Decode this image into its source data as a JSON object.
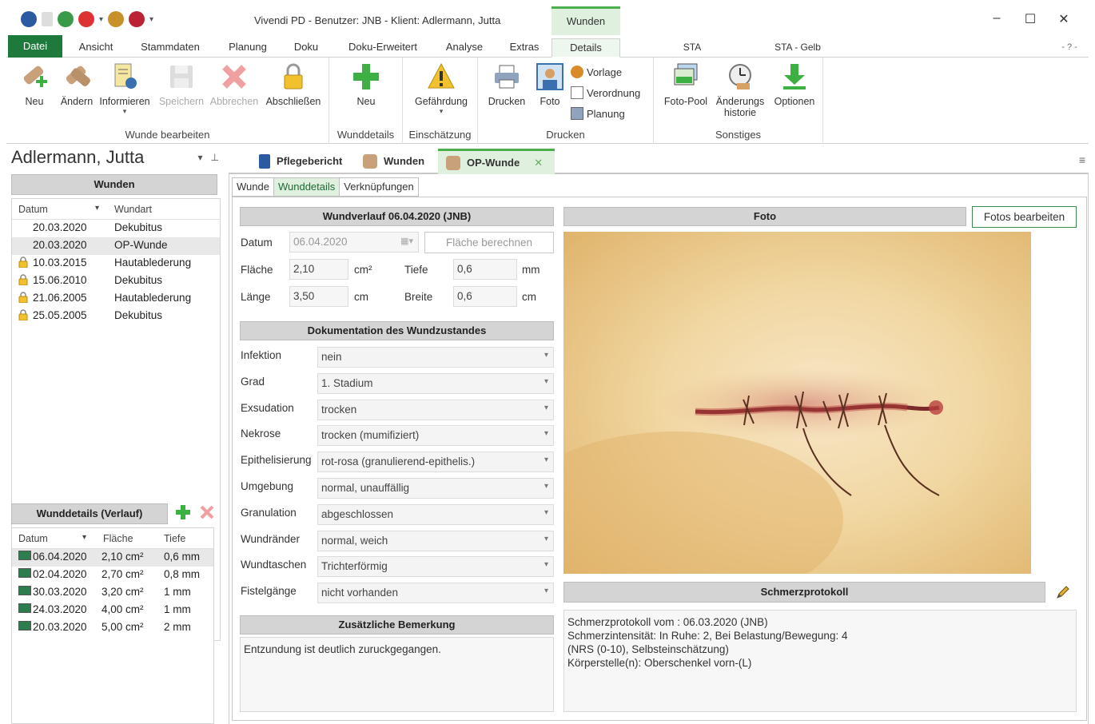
{
  "window": {
    "title": "Vivendi PD - Benutzer: JNB - Klient: Adlermann, Jutta",
    "context_tab": "Wunden",
    "controls": [
      "–",
      "☐",
      "✕"
    ]
  },
  "ribbon_tabs": [
    "Datei",
    "Ansicht",
    "Stammdaten",
    "Planung",
    "Doku",
    "Doku-Erweitert",
    "Analyse",
    "Extras",
    "Details"
  ],
  "ribbon_right": {
    "sta": "STA",
    "sta_gelb": "STA - Gelb",
    "help": "- ? -"
  },
  "ribbon": {
    "groups": {
      "wunde_bearbeiten": "Wunde bearbeiten",
      "wunddetails": "Wunddetails",
      "einschaetzung": "Einschätzung",
      "drucken": "Drucken",
      "sonstiges": "Sonstiges"
    },
    "buttons": {
      "neu": "Neu",
      "aendern": "Ändern",
      "informieren": "Informieren",
      "speichern": "Speichern",
      "abbrechen": "Abbrechen",
      "abschliessen": "Abschließen",
      "neu_details": "Neu",
      "gefaehrdung": "Gefährdung",
      "drucken": "Drucken",
      "foto": "Foto",
      "vorlage": "Vorlage",
      "verordnung": "Verordnung",
      "planung": "Planung",
      "foto_pool": "Foto-Pool",
      "aenderungs_l1": "Änderungs",
      "aenderungs_l2": "historie",
      "optionen": "Optionen"
    },
    "icon_colors": {
      "green": "#3cb043",
      "bandage": "#c8a079",
      "red": "#e06060",
      "yellow": "#f2c12e",
      "blue": "#3a6fb0"
    }
  },
  "left": {
    "patient": "Adlermann, Jutta",
    "wunden_header": "Wunden",
    "wunden_cols": [
      "Datum",
      "Wundart"
    ],
    "wunden": [
      {
        "datum": "20.03.2020",
        "art": "Dekubitus",
        "locked": false,
        "selected": false
      },
      {
        "datum": "20.03.2020",
        "art": "OP-Wunde",
        "locked": false,
        "selected": true
      },
      {
        "datum": "10.03.2015",
        "art": "Hautablederung",
        "locked": true,
        "selected": false
      },
      {
        "datum": "15.06.2010",
        "art": "Dekubitus",
        "locked": true,
        "selected": false
      },
      {
        "datum": "21.06.2005",
        "art": "Hautablederung",
        "locked": true,
        "selected": false
      },
      {
        "datum": "25.05.2005",
        "art": "Dekubitus",
        "locked": true,
        "selected": false
      }
    ],
    "verlauf_header": "Wunddetails (Verlauf)",
    "verlauf_cols": [
      "Datum",
      "Fläche",
      "Tiefe"
    ],
    "verlauf": [
      {
        "datum": "06.04.2020",
        "flaeche": "2,10 cm²",
        "tiefe": "0,6 mm"
      },
      {
        "datum": "02.04.2020",
        "flaeche": "2,70 cm²",
        "tiefe": "0,8 mm"
      },
      {
        "datum": "30.03.2020",
        "flaeche": "3,20 cm²",
        "tiefe": "1 mm"
      },
      {
        "datum": "24.03.2020",
        "flaeche": "4,00 cm²",
        "tiefe": "1 mm"
      },
      {
        "datum": "20.03.2020",
        "flaeche": "5,00 cm²",
        "tiefe": "2 mm"
      }
    ]
  },
  "doc_tabs": [
    "Pflegebericht",
    "Wunden",
    "OP-Wunde"
  ],
  "sub_tabs": [
    "Wunde",
    "Wunddetails",
    "Verknüpfungen"
  ],
  "verlauf_section": {
    "header": "Wundverlauf 06.04.2020 (JNB)",
    "datum_label": "Datum",
    "datum_value": "06.04.2020",
    "flaeche_btn": "Fläche berechnen",
    "flaeche_label": "Fläche",
    "flaeche_value": "2,10",
    "flaeche_unit": "cm²",
    "tiefe_label": "Tiefe",
    "tiefe_value": "0,6",
    "tiefe_unit": "mm",
    "laenge_label": "Länge",
    "laenge_value": "3,50",
    "laenge_unit": "cm",
    "breite_label": "Breite",
    "breite_value": "0,6",
    "breite_unit": "cm"
  },
  "doku_section": {
    "header": "Dokumentation des Wundzustandes",
    "rows": [
      {
        "label": "Infektion",
        "value": "nein"
      },
      {
        "label": "Grad",
        "value": "1. Stadium"
      },
      {
        "label": "Exsudation",
        "value": "trocken"
      },
      {
        "label": "Nekrose",
        "value": "trocken (mumifiziert)"
      },
      {
        "label": "Epithelisierung",
        "value": "rot-rosa (granulierend-epithelis.)"
      },
      {
        "label": "Umgebung",
        "value": "normal, unauffällig"
      },
      {
        "label": "Granulation",
        "value": "abgeschlossen"
      },
      {
        "label": "Wundränder",
        "value": "normal, weich"
      },
      {
        "label": "Wundtaschen",
        "value": "Trichterförmig"
      },
      {
        "label": "Fistelgänge",
        "value": "nicht vorhanden"
      }
    ]
  },
  "bemerkung": {
    "header": "Zusätzliche Bemerkung",
    "text": "Entzundung ist deutlich zuruckgegangen."
  },
  "foto": {
    "header": "Foto",
    "button": "Fotos bearbeiten"
  },
  "schmerz": {
    "header": "Schmerzprotokoll",
    "lines": [
      "Schmerzprotokoll vom : 06.03.2020 (JNB)",
      "Schmerzintensität: In Ruhe: 2, Bei Belastung/Bewegung: 4",
      "(NRS (0-10), Selbsteinschätzung)",
      "Körperstelle(n): Oberschenkel vorn-(L)"
    ]
  }
}
